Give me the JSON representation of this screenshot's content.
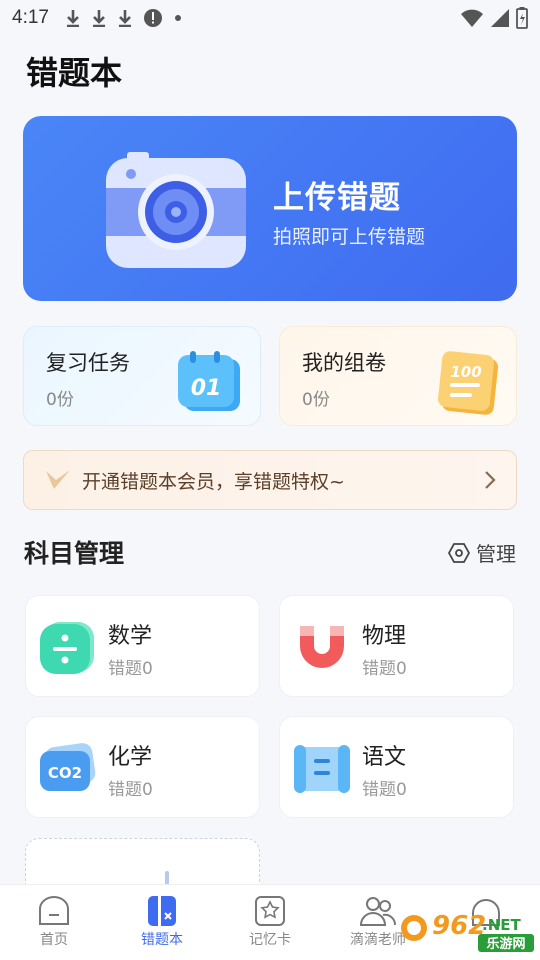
{
  "status_bar": {
    "time": "4:17",
    "icons": [
      "download-icon",
      "download-icon",
      "download-icon",
      "alert-icon",
      "dot-icon"
    ],
    "right_icons": [
      "wifi-icon",
      "signal-icon",
      "battery-icon"
    ]
  },
  "page_title": "错题本",
  "upload": {
    "title": "上传错题",
    "subtitle": "拍照即可上传错题",
    "icon": "camera-icon"
  },
  "review_task": {
    "title": "复习任务",
    "count": "0份",
    "icon_text": "01"
  },
  "my_paper": {
    "title": "我的组卷",
    "count": "0份",
    "icon_text": "100"
  },
  "member": {
    "text": "开通错题本会员，享错题特权~"
  },
  "subjects_section": {
    "title": "科目管理",
    "manage_label": "管理"
  },
  "subjects": [
    {
      "name": "数学",
      "count": "错题0",
      "icon": "math-divide-icon",
      "color": "#3fd9b1"
    },
    {
      "name": "物理",
      "count": "错题0",
      "icon": "magnet-icon",
      "color": "#f25b5b"
    },
    {
      "name": "化学",
      "count": "错题0",
      "icon": "co2-icon",
      "color": "#4a9cf0"
    },
    {
      "name": "语文",
      "count": "错题0",
      "icon": "scroll-icon",
      "color": "#5bb6f5"
    }
  ],
  "nav": [
    {
      "label": "首页",
      "icon": "home-icon"
    },
    {
      "label": "错题本",
      "icon": "mistake-book-icon",
      "active": true
    },
    {
      "label": "记忆卡",
      "icon": "memory-card-icon"
    },
    {
      "label": "滴滴老师",
      "icon": "teacher-icon"
    },
    {
      "label": "",
      "icon": "profile-icon"
    }
  ],
  "watermark": {
    "number": "962",
    "suffix": ".NET",
    "text": "乐游网"
  },
  "colors": {
    "primary": "#3f6bf0",
    "background": "#f6f7fa"
  }
}
